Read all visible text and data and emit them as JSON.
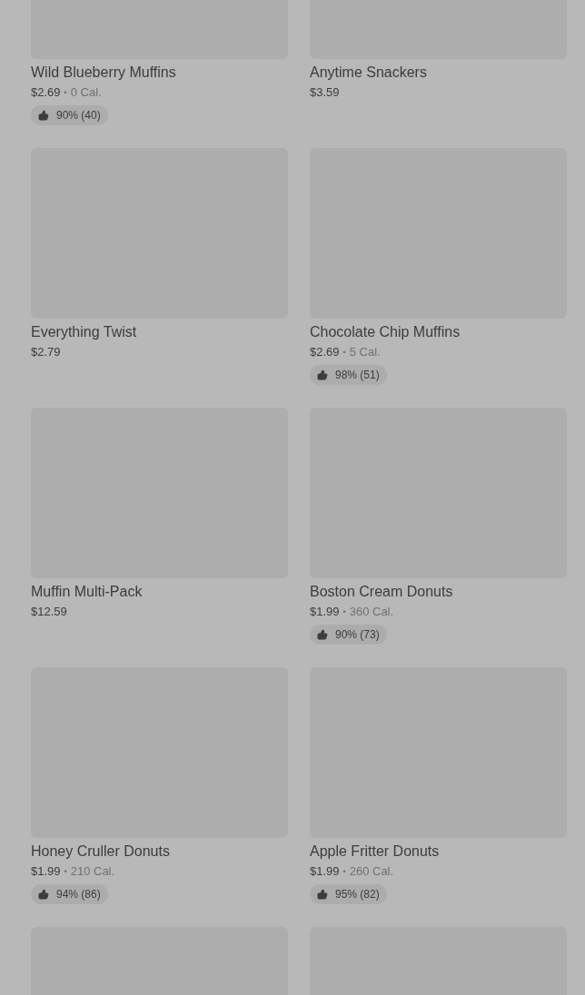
{
  "products": [
    {
      "kind": "full",
      "name": "Wild Blueberry Muffins",
      "price": "$2.69",
      "separator": "•",
      "calories": "0 Cal.",
      "rating": "90% (40)"
    },
    {
      "kind": "full",
      "name": "Anytime Snackers",
      "price": "$3.59"
    },
    {
      "kind": "full",
      "name": "Everything Twist",
      "price": "$2.79"
    },
    {
      "kind": "full",
      "name": "Chocolate Chip Muffins",
      "price": "$2.69",
      "separator": "•",
      "calories": "5 Cal.",
      "rating": "98% (51)"
    },
    {
      "kind": "full",
      "name": "Muffin Multi-Pack",
      "price": "$12.59"
    },
    {
      "kind": "full",
      "name": "Boston Cream Donuts",
      "price": "$1.99",
      "separator": "•",
      "calories": "360 Cal.",
      "rating": "90% (73)"
    },
    {
      "kind": "full",
      "name": "Honey Cruller Donuts",
      "price": "$1.99",
      "separator": "•",
      "calories": "210 Cal.",
      "rating": "94% (86)"
    },
    {
      "kind": "full",
      "name": "Apple Fritter Donuts",
      "price": "$1.99",
      "separator": "•",
      "calories": "260 Cal.",
      "rating": "95% (82)"
    },
    {
      "kind": "image_only"
    },
    {
      "kind": "image_only"
    }
  ]
}
